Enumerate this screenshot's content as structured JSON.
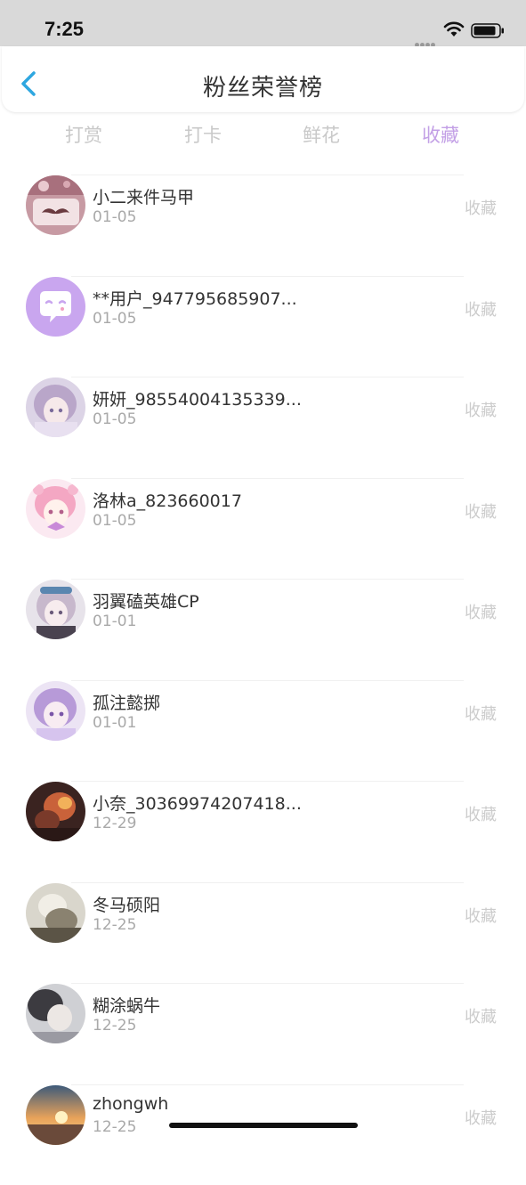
{
  "status_bar": {
    "time": "7:25"
  },
  "header": {
    "title": "粉丝荣誉榜"
  },
  "tabs": [
    {
      "label": "打赏",
      "active": false
    },
    {
      "label": "打卡",
      "active": false
    },
    {
      "label": "鲜花",
      "active": false
    },
    {
      "label": "收藏",
      "active": true
    }
  ],
  "rows": [
    {
      "name": "小二来件马甲",
      "date": "01-05",
      "action": "收藏",
      "avatar": "avatar-mustache"
    },
    {
      "name": "**用户_947795685907...",
      "date": "01-05",
      "action": "收藏",
      "avatar": "avatar-chat-bubble"
    },
    {
      "name": "妍妍_98554004135339...",
      "date": "01-05",
      "action": "收藏",
      "avatar": "avatar-anime-1"
    },
    {
      "name": "洛林a_823660017",
      "date": "01-05",
      "action": "收藏",
      "avatar": "avatar-anime-2"
    },
    {
      "name": "羽翼磕英雄CP",
      "date": "01-01",
      "action": "收藏",
      "avatar": "avatar-anime-3"
    },
    {
      "name": "孤注懿掷",
      "date": "01-01",
      "action": "收藏",
      "avatar": "avatar-anime-4"
    },
    {
      "name": "小奈_30369974207418...",
      "date": "12-29",
      "action": "收藏",
      "avatar": "avatar-photo-1"
    },
    {
      "name": "冬马硕阳",
      "date": "12-25",
      "action": "收藏",
      "avatar": "avatar-photo-2"
    },
    {
      "name": "糊涂蜗牛",
      "date": "12-25",
      "action": "收藏",
      "avatar": "avatar-photo-3"
    },
    {
      "name": "zhongwh",
      "date": "12-25",
      "action": "收藏",
      "avatar": "avatar-sunset"
    }
  ],
  "colors": {
    "accent": "#c3a0e6",
    "tab_inactive": "#c9c9c9",
    "text_primary": "#333333",
    "text_secondary": "#a9a9a9",
    "back_arrow": "#2ea7e0",
    "status_bar_bg": "#d9d9d9"
  }
}
